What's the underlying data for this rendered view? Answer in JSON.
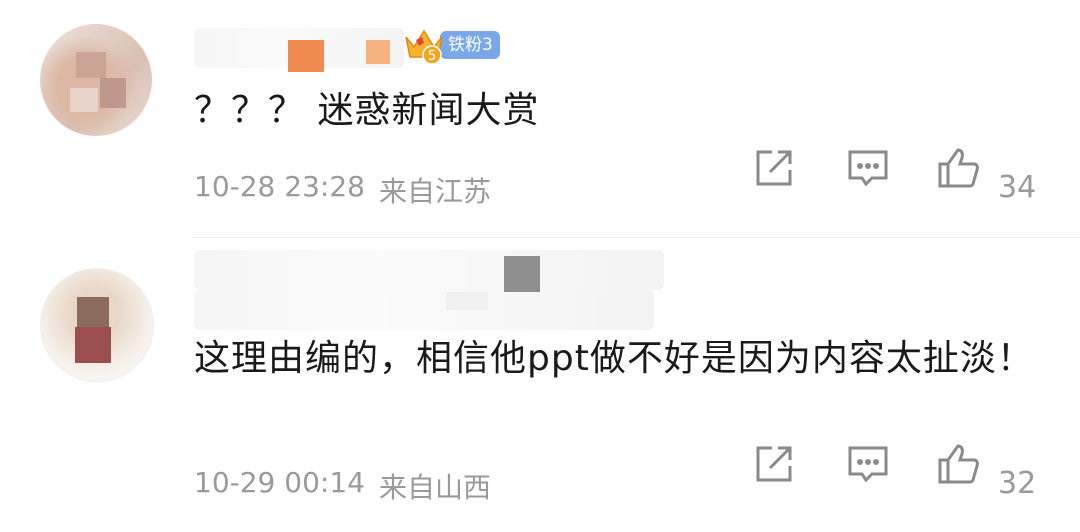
{
  "comments": [
    {
      "badge": {
        "fan_label": "铁粉3",
        "crown_level": "5"
      },
      "text": "？？？ 迷惑新闻大赏",
      "time": "10-28 23:28",
      "location": "来自江苏",
      "like_count": "34"
    },
    {
      "text": "这理由编的，相信他ppt做不好是因为内容太扯淡！",
      "time": "10-29 00:14",
      "location": "来自山西",
      "like_count": "32"
    }
  ],
  "icons": [
    "share-icon",
    "reply-icon",
    "like-icon"
  ],
  "colors": {
    "meta": "#9a9a9a",
    "text": "#1a1a1a",
    "fan_badge": "#7aa7e8",
    "crown": "#f5b32e"
  }
}
